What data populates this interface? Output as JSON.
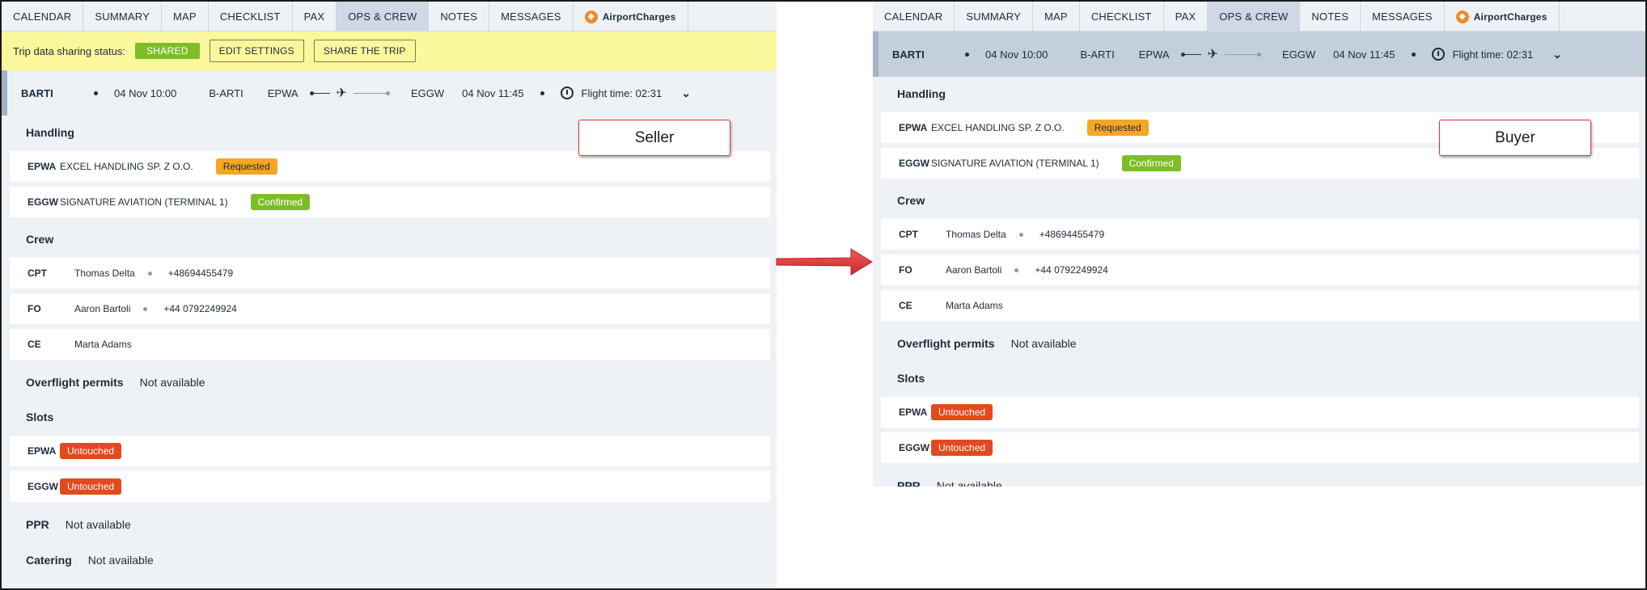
{
  "tabs": [
    "CALENDAR",
    "SUMMARY",
    "MAP",
    "CHECKLIST",
    "PAX",
    "OPS & CREW",
    "NOTES",
    "MESSAGES"
  ],
  "tab_active": "OPS & CREW",
  "airport_charges_label": "AirportCharges",
  "share": {
    "status_label": "Trip data sharing status:",
    "status_badge": "SHARED",
    "edit_btn": "EDIT SETTINGS",
    "share_btn": "SHARE THE TRIP"
  },
  "trip": {
    "callsign": "BARTI",
    "dep_time": "04 Nov 10:00",
    "reg": "B-ARTI",
    "from": "EPWA",
    "to": "EGGW",
    "arr_time": "04 Nov 11:45",
    "flight_time": "Flight time: 02:31"
  },
  "labels": {
    "handling": "Handling",
    "crew": "Crew",
    "overflight": "Overflight permits",
    "slots": "Slots",
    "ppr": "PPR",
    "catering": "Catering",
    "not_available": "Not available"
  },
  "handling": [
    {
      "code": "EPWA",
      "name": "EXCEL HANDLING SP. Z O.O.",
      "status": "Requested"
    },
    {
      "code": "EGGW",
      "name": "SIGNATURE AVIATION (TERMINAL 1)",
      "status": "Confirmed"
    }
  ],
  "crew": [
    {
      "role": "CPT",
      "name": "Thomas Delta",
      "phone": "+48694455479"
    },
    {
      "role": "FO",
      "name": "Aaron Bartoli",
      "phone": "+44 0792249924"
    },
    {
      "role": "CE",
      "name": "Marta Adams",
      "phone": ""
    }
  ],
  "slots": [
    {
      "code": "EPWA",
      "status": "Untouched"
    },
    {
      "code": "EGGW",
      "status": "Untouched"
    }
  ],
  "callouts": {
    "seller": "Seller",
    "buyer": "Buyer"
  },
  "colors": {
    "shared": "#7dbe27",
    "requested": "#f5a623",
    "confirmed": "#7dbe27",
    "untouched": "#e2491d",
    "arrow": "#e5393b",
    "share_bar": "#fbf79c"
  }
}
